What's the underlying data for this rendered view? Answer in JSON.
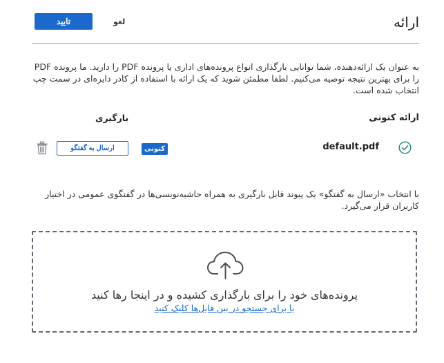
{
  "header": {
    "title": "ارائه",
    "confirm_label": "تایید",
    "cancel_label": "لغو"
  },
  "intro_text": "به عنوان یک ارائه‌دهنده، شما توانایی بارگذاری انواع پرونده‌های اداری یا پرونده PDF را دارید. ما پرونده PDF را برای بهترین نتیجه توصیه می‌کنیم. لطفا مطمئن شوید که یک ارائه با استفاده از کادر دایره‌ای در سمت چپ انتخاب شده است.",
  "table": {
    "current_header": "ارائه کنونی",
    "download_header": "بارگیری",
    "rows": [
      {
        "filename": "default.pdf",
        "badge": "کنونی",
        "send_label": "ارسال به گفتگو",
        "check_icon": "check-circle-icon",
        "delete_icon": "trash-icon"
      }
    ]
  },
  "note_text": "با انتخاب «ارسال به گفتگو» یک پیوند قابل بارگیری به همراه حاشیه‌نویسی‌ها در گفتگوی عمومی در اختیار کاربران قرار می‌گیرد.",
  "dropzone": {
    "icon": "cloud-upload-icon",
    "main_text": "پرونده‌های خود را برای بارگذاری کشیده و در اینجا رها کنید",
    "link_text": "یا برای جستجو در بین فایل‌ها کلیک کنید"
  },
  "colors": {
    "accent": "#1b69cc",
    "check": "#2e8b7e",
    "border": "#5f6670"
  }
}
